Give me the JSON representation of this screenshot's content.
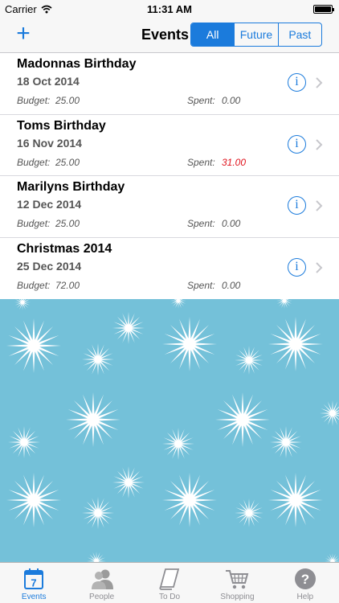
{
  "status_bar": {
    "carrier": "Carrier",
    "time": "11:31 AM"
  },
  "nav": {
    "add_label": "+",
    "title": "Events",
    "segments": [
      {
        "label": "All",
        "active": true
      },
      {
        "label": "Future",
        "active": false
      },
      {
        "label": "Past",
        "active": false
      }
    ]
  },
  "events": [
    {
      "name": "Madonnas Birthday",
      "date": "18 Oct 2014",
      "budget_label": "Budget:",
      "budget": "25.00",
      "spent_label": "Spent:",
      "spent": "0.00",
      "over_budget": false
    },
    {
      "name": "Toms Birthday",
      "date": "16 Nov 2014",
      "budget_label": "Budget:",
      "budget": "25.00",
      "spent_label": "Spent:",
      "spent": "31.00",
      "over_budget": true
    },
    {
      "name": "Marilyns Birthday",
      "date": "12 Dec 2014",
      "budget_label": "Budget:",
      "budget": "25.00",
      "spent_label": "Spent:",
      "spent": "0.00",
      "over_budget": false
    },
    {
      "name": "Christmas 2014",
      "date": "25 Dec 2014",
      "budget_label": "Budget:",
      "budget": "72.00",
      "spent_label": "Spent:",
      "spent": "0.00",
      "over_budget": false
    }
  ],
  "row_icons": {
    "info": "i",
    "info_icon": "info-icon",
    "chevron_icon": "chevron-right-icon"
  },
  "tabs": [
    {
      "label": "Events",
      "icon": "calendar-icon",
      "icon_text": "7",
      "active": true
    },
    {
      "label": "People",
      "icon": "people-icon",
      "active": false
    },
    {
      "label": "To Do",
      "icon": "note-icon",
      "active": false
    },
    {
      "label": "Shopping",
      "icon": "cart-icon",
      "active": false
    },
    {
      "label": "Help",
      "icon": "help-icon",
      "icon_text": "?",
      "active": false
    }
  ],
  "colors": {
    "accent": "#1b7bdc",
    "over_budget": "#e0121c",
    "pattern_bg": "#74c1d9",
    "star": "#ffffff"
  }
}
